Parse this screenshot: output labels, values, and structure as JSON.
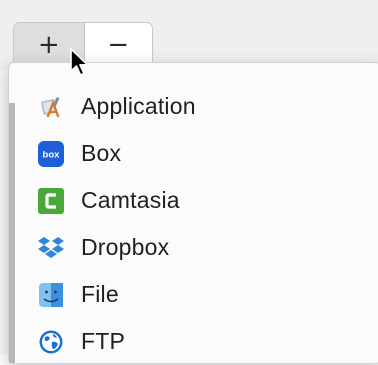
{
  "toolbar": {
    "add_symbol": "+",
    "remove_symbol": "−"
  },
  "menu": {
    "items": [
      {
        "label": "Application",
        "icon": "application-icon"
      },
      {
        "label": "Box",
        "icon": "box-icon",
        "icon_text": "box"
      },
      {
        "label": "Camtasia",
        "icon": "camtasia-icon"
      },
      {
        "label": "Dropbox",
        "icon": "dropbox-icon"
      },
      {
        "label": "File",
        "icon": "finder-file-icon"
      },
      {
        "label": "FTP",
        "icon": "ftp-globe-icon"
      }
    ]
  },
  "colors": {
    "box_brand": "#1c5fd6",
    "camtasia_brand": "#4aa83a",
    "dropbox_brand": "#2f86dc",
    "finder_blue": "#3d8fe0",
    "ftp_blue": "#1f6fd1"
  }
}
